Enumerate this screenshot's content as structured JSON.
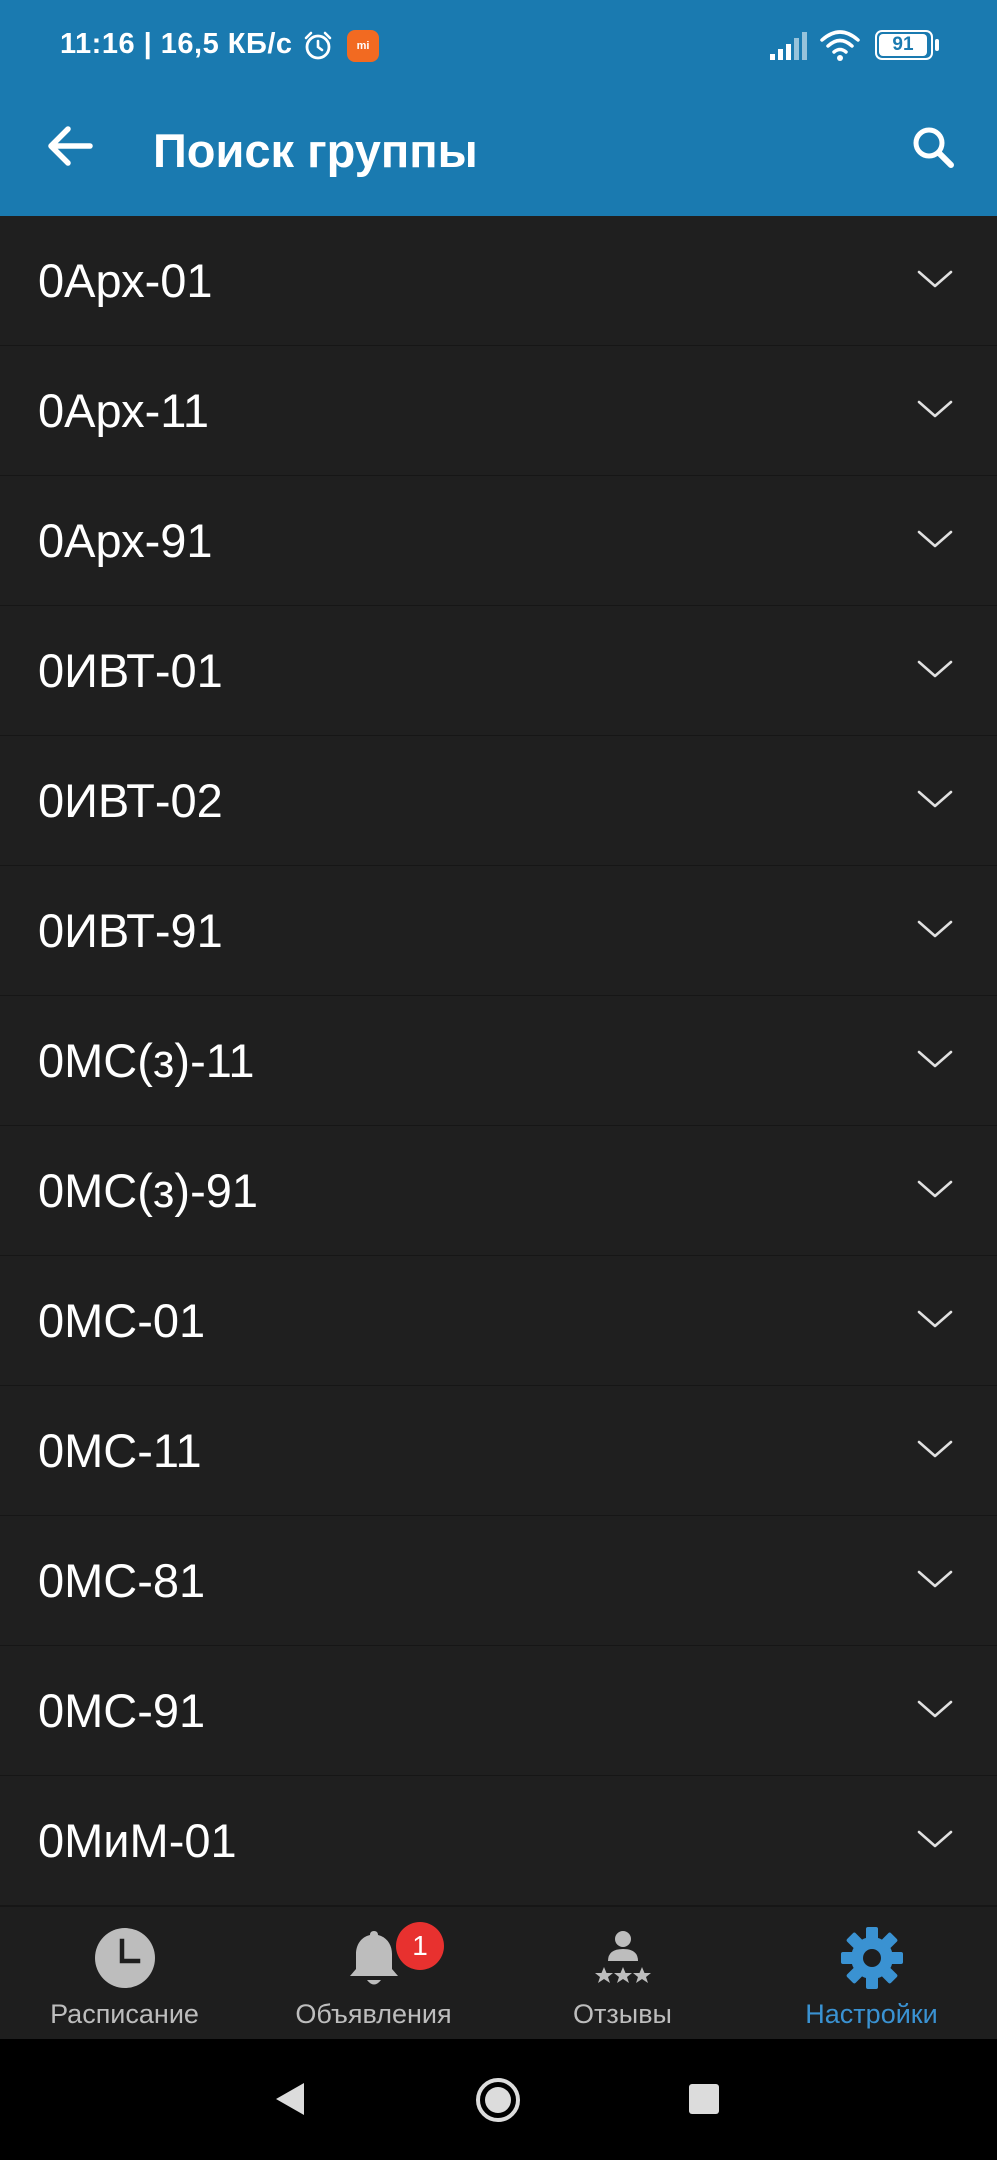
{
  "status_bar": {
    "time": "11:16 | 16,5 КБ/с",
    "battery": "91",
    "mi_badge": "mi"
  },
  "app_bar": {
    "title": "Поиск группы"
  },
  "groups": [
    {
      "label": "0Арх-01"
    },
    {
      "label": "0Арх-11"
    },
    {
      "label": "0Арх-91"
    },
    {
      "label": "0ИВТ-01"
    },
    {
      "label": "0ИВТ-02"
    },
    {
      "label": "0ИВТ-91"
    },
    {
      "label": "0МС(з)-11"
    },
    {
      "label": "0МС(з)-91"
    },
    {
      "label": "0МС-01"
    },
    {
      "label": "0МС-11"
    },
    {
      "label": "0МС-81"
    },
    {
      "label": "0МС-91"
    },
    {
      "label": "0МиМ-01"
    }
  ],
  "bottom_nav": {
    "items": [
      {
        "label": "Расписание",
        "icon": "clock-icon",
        "active": false
      },
      {
        "label": "Объявления",
        "icon": "bell-icon",
        "active": false,
        "badge": "1"
      },
      {
        "label": "Отзывы",
        "icon": "reviews-icon",
        "active": false
      },
      {
        "label": "Настройки",
        "icon": "gear-icon",
        "active": true
      }
    ]
  },
  "colors": {
    "primary": "#1a7ab0",
    "background": "#1e1e1e",
    "active_nav": "#3a92d2",
    "badge": "#e8312f"
  }
}
